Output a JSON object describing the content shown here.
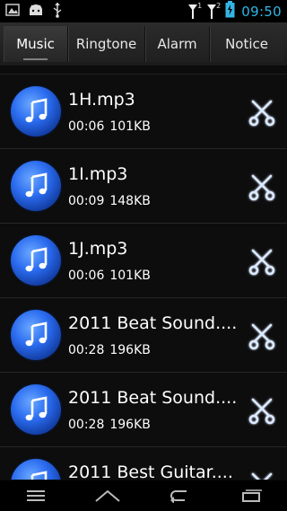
{
  "status_bar": {
    "time": "09:50",
    "icons": [
      "screenshot-icon",
      "android-debug-icon",
      "usb-icon",
      "signal-1-icon",
      "signal-2-icon",
      "battery-charging-icon"
    ],
    "signal_labels": [
      "1",
      "2"
    ],
    "accent_color": "#34b5e5"
  },
  "tabs": [
    {
      "label": "Music",
      "active": true
    },
    {
      "label": "Ringtone",
      "active": false
    },
    {
      "label": "Alarm",
      "active": false
    },
    {
      "label": "Notice",
      "active": false
    }
  ],
  "files": [
    {
      "name": "1H.mp3",
      "duration": "00:06",
      "size": "101KB"
    },
    {
      "name": "1I.mp3",
      "duration": "00:09",
      "size": "148KB"
    },
    {
      "name": "1J.mp3",
      "duration": "00:06",
      "size": "101KB"
    },
    {
      "name": "2011 Beat Sound....",
      "duration": "00:28",
      "size": "196KB"
    },
    {
      "name": "2011 Beat Sound....",
      "duration": "00:28",
      "size": "196KB"
    },
    {
      "name": "2011 Best Guitar....",
      "duration": "",
      "size": ""
    }
  ],
  "nav_bar": {
    "icons": [
      "menu-icon",
      "home-icon",
      "back-icon",
      "recent-apps-icon"
    ]
  }
}
